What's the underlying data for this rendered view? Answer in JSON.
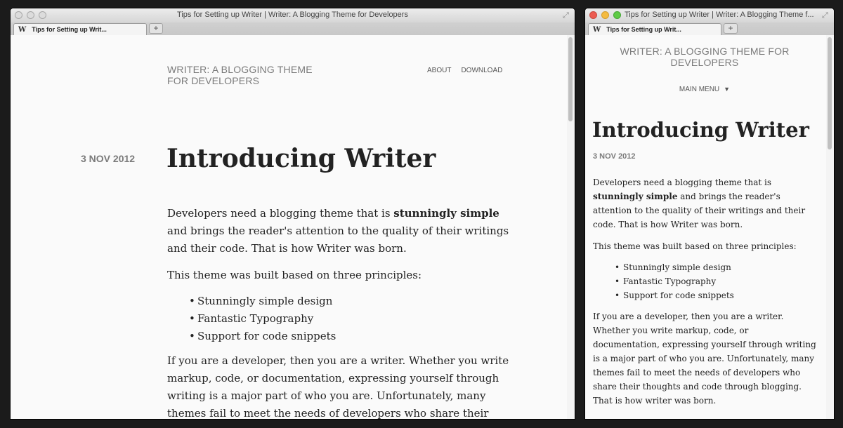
{
  "window_large": {
    "title": "Tips for Setting up Writer | Writer: A Blogging Theme for Developers",
    "tab_label": "Tips for Setting up Writ...",
    "favicon": "W",
    "new_tab": "+"
  },
  "window_small": {
    "title": "Tips for Setting up Writer | Writer: A Blogging Theme f...",
    "tab_label": "Tips for Setting up Writ...",
    "favicon": "W",
    "new_tab": "+"
  },
  "site": {
    "title": "WRITER: A BLOGGING THEME FOR DEVELOPERS",
    "nav": {
      "about": "ABOUT",
      "download": "DOWNLOAD"
    },
    "main_menu": "MAIN MENU",
    "menu_arrow": "▼"
  },
  "post": {
    "date": "3 NOV 2012",
    "title": "Introducing Writer",
    "p1_before": "Developers need a blogging theme that is ",
    "p1_bold": "stunningly simple",
    "p1_after": " and brings the reader's attention to the quality of their writings and their code. That is how Writer was born.",
    "p2": "This theme was built based on three principles:",
    "principles": [
      "Stunningly simple design",
      "Fantastic Typography",
      "Support for code snippets"
    ],
    "p3_large": "If you are a developer, then you are a writer. Whether you write markup, code, or documentation, expressing yourself through writing is a major part of who you are. Unfortunately, many themes fail to meet the needs of developers who share their",
    "p3_small": "If you are a developer, then you are a writer. Whether you write markup, code, or documentation, expressing yourself through writing is a major part of who you are. Unfortunately, many themes fail to meet the needs of developers who share their thoughts and code through blogging. That is how writer was born."
  },
  "icons": {
    "fullscreen": "fullscreen-icon",
    "traffic_lights": [
      "close",
      "minimize",
      "zoom"
    ]
  },
  "colors": {
    "page_bg": "#fafafa",
    "text": "#222222",
    "muted": "#7a7a7a",
    "close": "#ec5c52",
    "minimize": "#f4bb41",
    "zoom": "#5fcb46"
  }
}
